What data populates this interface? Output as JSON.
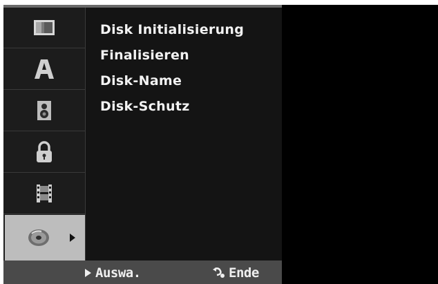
{
  "sidebar": {
    "items": [
      {
        "icon": "screen-icon"
      },
      {
        "icon": "letter-a-icon"
      },
      {
        "icon": "speaker-icon"
      },
      {
        "icon": "lock-icon"
      },
      {
        "icon": "film-icon"
      },
      {
        "icon": "disc-icon",
        "active": true
      }
    ]
  },
  "menu": {
    "items": [
      {
        "label": "Disk Initialisierung"
      },
      {
        "label": "Finalisieren"
      },
      {
        "label": "Disk-Name"
      },
      {
        "label": "Disk-Schutz"
      }
    ]
  },
  "footer": {
    "select_label": "Auswa.",
    "exit_label": "Ende"
  },
  "colors": {
    "panel_bg": "#141414",
    "sidebar_bg": "#1c1c1c",
    "active_bg": "#bdbdbd",
    "footer_bg": "#4a4a4a",
    "text": "#f2f2f2"
  }
}
